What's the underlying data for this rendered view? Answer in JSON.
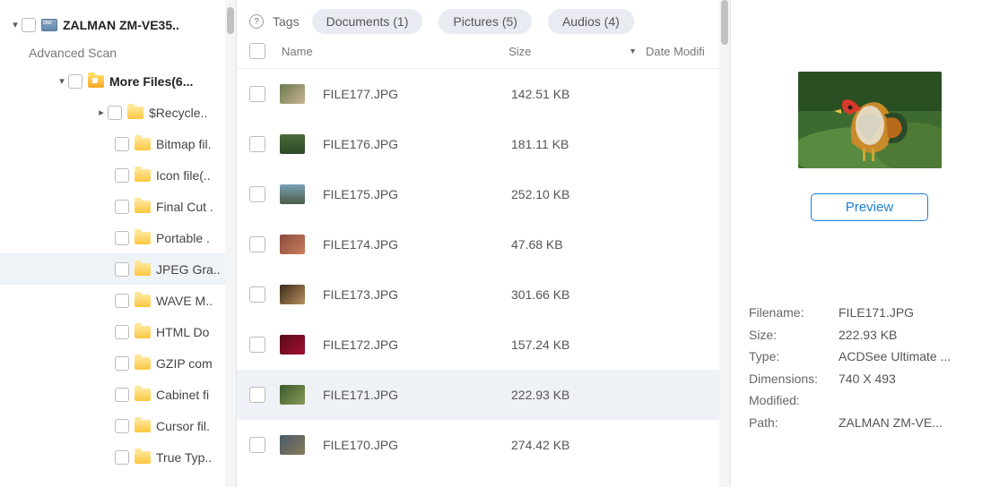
{
  "sidebar": {
    "drive_label": "ZALMAN  ZM-VE35..",
    "advanced_scan": "Advanced Scan",
    "more_files": "More Files(6...",
    "folders": [
      "$Recycle..",
      "Bitmap fil.",
      "Icon file(..",
      "Final Cut .",
      "Portable .",
      "JPEG Gra..",
      "WAVE M..",
      "HTML Do",
      "GZIP com",
      "Cabinet fi",
      "Cursor fil.",
      "True Typ.."
    ]
  },
  "tags": {
    "label": "Tags",
    "chips": [
      "Documents (1)",
      "Pictures (5)",
      "Audios (4)"
    ]
  },
  "columns": {
    "name": "Name",
    "size": "Size",
    "date": "Date Modifi"
  },
  "files": [
    {
      "name": "FILE177.JPG",
      "size": "142.51 KB",
      "thumb": "th-0"
    },
    {
      "name": "FILE176.JPG",
      "size": "181.11 KB",
      "thumb": "th-1"
    },
    {
      "name": "FILE175.JPG",
      "size": "252.10 KB",
      "thumb": "th-2"
    },
    {
      "name": "FILE174.JPG",
      "size": "47.68 KB",
      "thumb": "th-3"
    },
    {
      "name": "FILE173.JPG",
      "size": "301.66 KB",
      "thumb": "th-4"
    },
    {
      "name": "FILE172.JPG",
      "size": "157.24 KB",
      "thumb": "th-5"
    },
    {
      "name": "FILE171.JPG",
      "size": "222.93 KB",
      "thumb": "th-6",
      "selected": true
    },
    {
      "name": "FILE170.JPG",
      "size": "274.42 KB",
      "thumb": "th-7"
    }
  ],
  "preview": {
    "button": "Preview",
    "meta": {
      "Filename": "FILE171.JPG",
      "Size": "222.93 KB",
      "Type": "ACDSee Ultimate ...",
      "Dimensions": "740 X 493",
      "Modified": "",
      "Path": "ZALMAN  ZM-VE..."
    }
  }
}
